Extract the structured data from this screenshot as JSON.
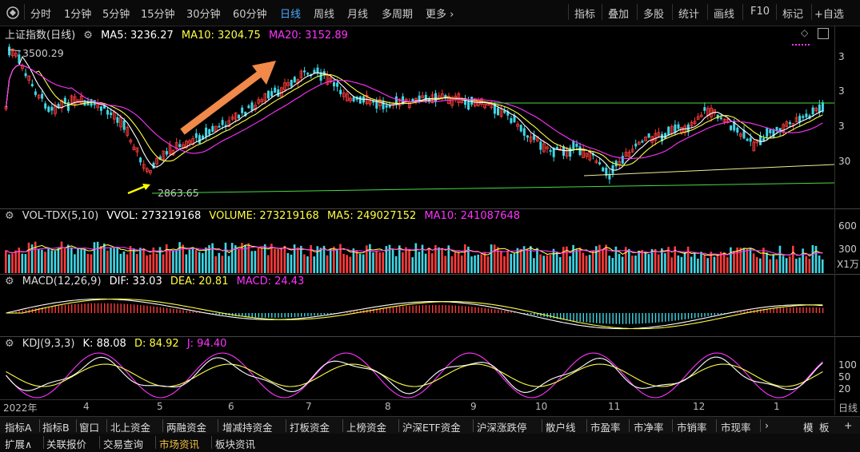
{
  "toolbar": {
    "periods": [
      "分时",
      "1分钟",
      "5分钟",
      "15分钟",
      "30分钟",
      "60分钟",
      "日线",
      "周线",
      "月线",
      "多周期",
      "更多 ›"
    ],
    "active_period": "日线",
    "tools": [
      "指标",
      "叠加",
      "多股",
      "统计",
      "画线",
      "F10",
      "标记",
      "+自选"
    ]
  },
  "main_panel": {
    "title": "上证指数(日线)",
    "ma5_label": "MA5: 3236.27",
    "ma10_label": "MA10: 3204.75",
    "ma20_label": "MA20: 3152.89",
    "high_label": "3500.29",
    "low_label": "2863.65",
    "axis_ticks": [
      "3",
      "3",
      "3",
      "30"
    ]
  },
  "volume_panel": {
    "title": "VOL-TDX(5,10)",
    "vvol": "VVOL: 273219168",
    "volume": "VOLUME: 273219168",
    "ma5": "MA5: 249027152",
    "ma10": "MA10: 241087648",
    "axis_ticks": [
      "600",
      "300",
      "X1万"
    ]
  },
  "macd_panel": {
    "title": "MACD(12,26,9)",
    "dif": "DIF: 33.03",
    "dea": "DEA: 20.81",
    "macd": "MACD: 24.43"
  },
  "kdj_panel": {
    "title": "KDJ(9,3,3)",
    "k": "K: 88.08",
    "d": "D: 84.92",
    "j": "J: 94.40",
    "axis_ticks": [
      "100",
      "50",
      "20"
    ]
  },
  "time_axis": {
    "labels": [
      "2022年",
      "4",
      "5",
      "6",
      "7",
      "8",
      "9",
      "10",
      "11",
      "12",
      "1"
    ],
    "right_label": "日线"
  },
  "bottom_tabs": [
    "指标A",
    "指标B",
    "窗口",
    "北上资金",
    "两融资金",
    "增减持资金",
    "打板资金",
    "上榜资金",
    "沪深ETF资金",
    "沪深涨跌停",
    "散户线",
    "市盈率",
    "市净率",
    "市销率",
    "市现率"
  ],
  "bottom_right": [
    "›",
    "模",
    "板",
    "+"
  ],
  "bottom_tabs2": [
    "扩展∧",
    "关联报价",
    "交易查询",
    "市场资讯",
    "板块资讯"
  ],
  "colors": {
    "up": "#ff3b3b",
    "down": "#3fd7e6",
    "ma5": "#ffffff",
    "ma10": "#ffff44",
    "ma20": "#ff33ff",
    "trend": "#44dd44",
    "arrow": "#f0894a"
  }
}
